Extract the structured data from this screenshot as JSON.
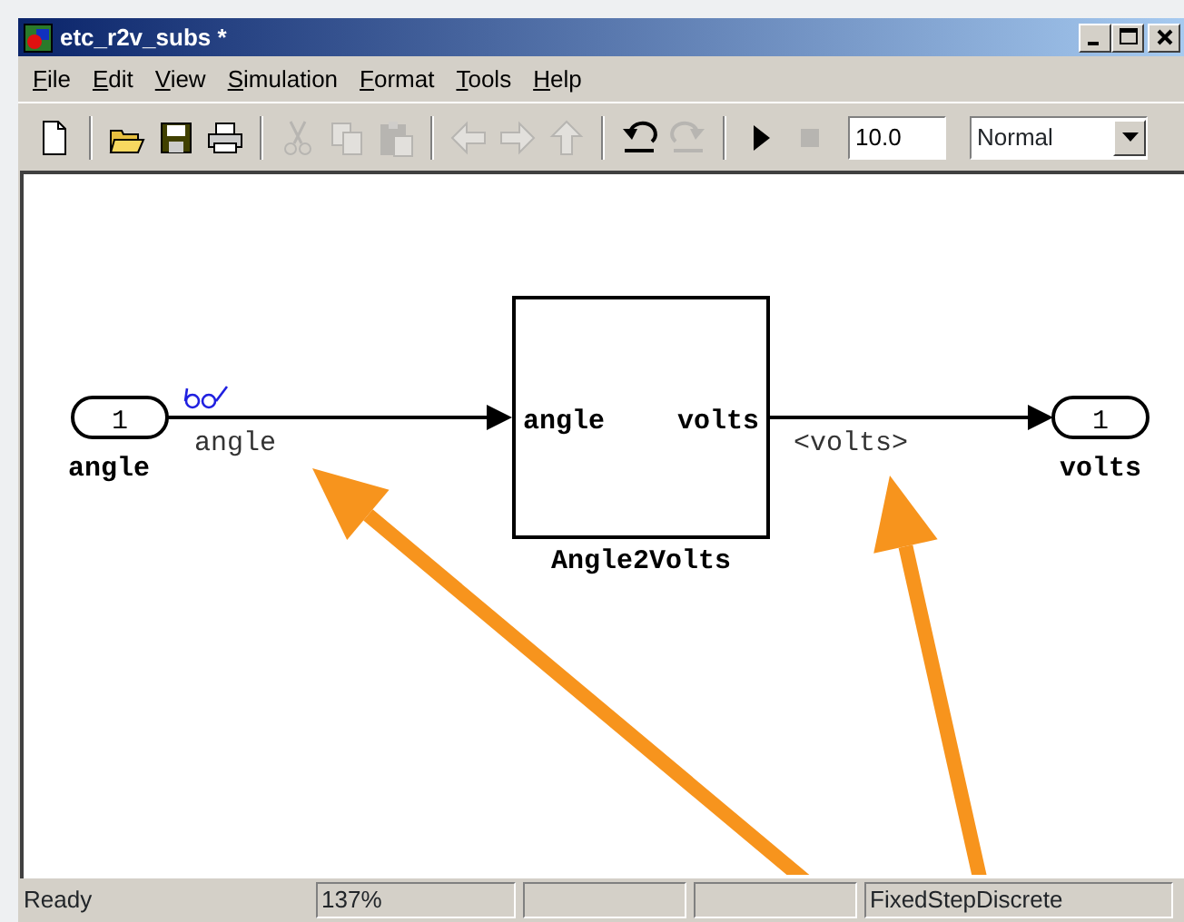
{
  "window": {
    "title": "etc_r2v_subs *",
    "controls": [
      {
        "kind": "minimize"
      },
      {
        "kind": "maximize"
      },
      {
        "kind": "close"
      }
    ]
  },
  "menu": [
    {
      "label": "File"
    },
    {
      "label": "Edit"
    },
    {
      "label": "View"
    },
    {
      "label": "Simulation"
    },
    {
      "label": "Format"
    },
    {
      "label": "Tools"
    },
    {
      "label": "Help"
    }
  ],
  "toolbar": {
    "buttons": [
      {
        "kind": "new",
        "disabled": false
      },
      {
        "kind": "separator"
      },
      {
        "kind": "open",
        "disabled": false
      },
      {
        "kind": "save",
        "disabled": false
      },
      {
        "kind": "print",
        "disabled": false
      },
      {
        "kind": "separator"
      },
      {
        "kind": "cut",
        "disabled": true
      },
      {
        "kind": "copy",
        "disabled": true
      },
      {
        "kind": "paste",
        "disabled": true
      },
      {
        "kind": "separator"
      },
      {
        "kind": "back",
        "disabled": true
      },
      {
        "kind": "forward",
        "disabled": true
      },
      {
        "kind": "up",
        "disabled": true
      },
      {
        "kind": "separator"
      },
      {
        "kind": "undo",
        "disabled": false
      },
      {
        "kind": "redo",
        "disabled": true
      },
      {
        "kind": "separator"
      },
      {
        "kind": "start",
        "disabled": false
      },
      {
        "kind": "stop",
        "disabled": true
      }
    ],
    "stop_time": "10.0",
    "mode": "Normal"
  },
  "diagram": {
    "inport": {
      "number": "1",
      "label": "angle"
    },
    "input_signal": {
      "label": "angle",
      "logged": true
    },
    "subsystem": {
      "name": "Angle2Volts",
      "input_port": "angle",
      "output_port": "volts"
    },
    "output_signal": {
      "label": "<volts>"
    },
    "outport": {
      "number": "1",
      "label": "volts"
    }
  },
  "status_bar": [
    {
      "text": "Ready"
    },
    {
      "text": "137%"
    },
    {
      "text": "FixedStepDiscrete"
    }
  ]
}
